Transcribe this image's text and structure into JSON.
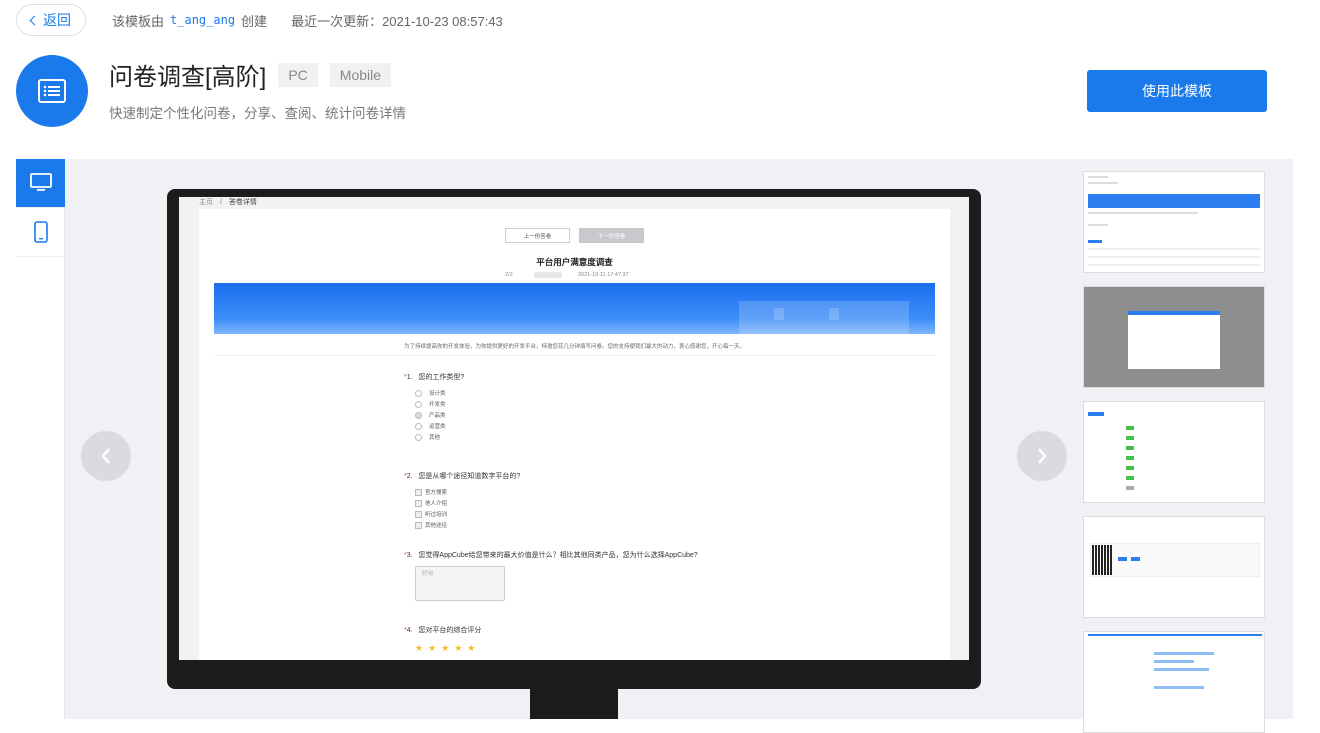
{
  "header": {
    "back_label": "返回",
    "created_prefix": "该模板由",
    "author": "t_ang_ang",
    "created_suffix": "创建",
    "updated": "最近一次更新：2021-10-23 08:57:43"
  },
  "template": {
    "title": "问卷调查[高阶]",
    "tags": [
      "PC",
      "Mobile"
    ],
    "description": "快速制定个性化问卷，分享、查阅、统计问卷详情",
    "use_button": "使用此模板"
  },
  "preview": {
    "view_tabs": [
      "desktop-icon",
      "mobile-icon"
    ],
    "active_tab": "desktop",
    "breadcrumb_home": "主页",
    "breadcrumb_sep": "/",
    "breadcrumb_current": "答卷详情",
    "prev_button": "上一份答卷",
    "next_button": "下一份答卷",
    "survey_title": "平台用户满意度调查",
    "meta_left": "2/2",
    "meta_time": "2021-10-11 17:47:37",
    "intro": "为了持续提高你的开发体验，为你提供更好的开发平台，特邀您花几分钟填写问卷。您的支持便我们最大的动力，衷心感谢您，开心每一天。",
    "questions": [
      {
        "num": "1.",
        "text": "您的工作类型?",
        "type": "radio",
        "options": [
          "设计类",
          "开发类",
          "产品类",
          "运营类",
          "其他"
        ]
      },
      {
        "num": "2.",
        "text": "您是从哪个途径知道数字平台的?",
        "type": "checkbox",
        "options": [
          "官方搜索",
          "他人介绍",
          "听过培训",
          "其他途径"
        ]
      },
      {
        "num": "3.",
        "text": "您觉得AppCube给您带来的最大价值是什么？相比其他同类产品，您为什么选择AppCube?",
        "type": "text",
        "placeholder": "好用"
      },
      {
        "num": "4.",
        "text": "您对平台的综合评分",
        "type": "rating",
        "stars": "★★★★★"
      }
    ],
    "thumbnails": 5
  },
  "colors": {
    "accent": "#1a7aeb",
    "preview_bg": "#f0f1f5"
  }
}
